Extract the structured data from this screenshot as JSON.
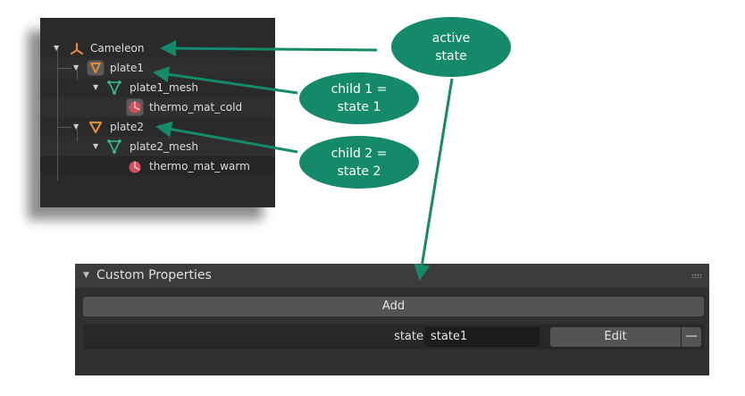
{
  "outliner": {
    "items": [
      {
        "label": "Cameleon",
        "icon": "empty-axes-icon"
      },
      {
        "label": "plate1",
        "icon": "mesh-object-icon"
      },
      {
        "label": "plate1_mesh",
        "icon": "mesh-data-icon"
      },
      {
        "label": "thermo_mat_cold",
        "icon": "material-icon"
      },
      {
        "label": "plate2",
        "icon": "mesh-object-icon"
      },
      {
        "label": "plate2_mesh",
        "icon": "mesh-data-icon"
      },
      {
        "label": "thermo_mat_warm",
        "icon": "material-icon"
      }
    ]
  },
  "callouts": {
    "active_line1": "active",
    "active_line2": "state",
    "child1_line1": "child 1 =",
    "child1_line2": "state 1",
    "child2_line1": "child 2 =",
    "child2_line2": "state 2"
  },
  "custom_properties": {
    "title": "Custom Properties",
    "add_label": "Add",
    "property_name": "state",
    "property_value": "state1",
    "edit_label": "Edit",
    "remove_label": "—"
  },
  "colors": {
    "callout": "#148a6a",
    "arrow": "#148a6a",
    "object_icon": "#e08a3a",
    "mesh_icon": "#33c08a",
    "material_icon": "#d84d5a"
  }
}
